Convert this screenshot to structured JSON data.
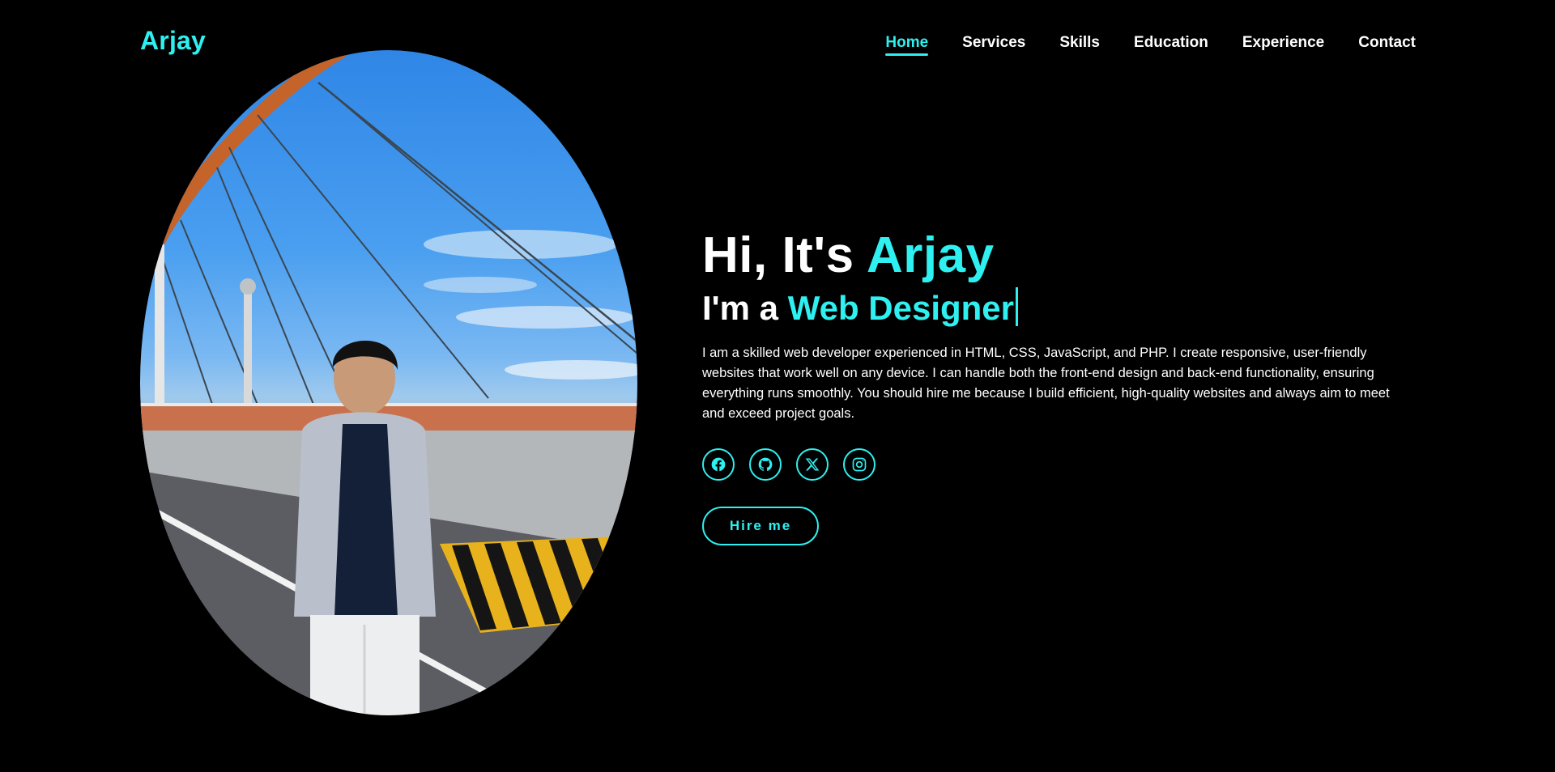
{
  "header": {
    "logo": "Arjay",
    "nav": [
      "Home",
      "Services",
      "Skills",
      "Education",
      "Experience",
      "Contact"
    ],
    "active_index": 0
  },
  "hero": {
    "greeting_prefix": "Hi, It's",
    "greeting_name": "Arjay",
    "role_prefix": "I'm a",
    "role_value": "Web Designer",
    "description": "I am a skilled web developer experienced in HTML, CSS, JavaScript, and PHP. I create responsive, user-friendly websites that work well on any device. I can handle both the front-end design and back-end functionality, ensuring everything runs smoothly. You should hire me because I build efficient, high-quality websites and always aim to meet and exceed project goals.",
    "hire_button": "Hire me"
  },
  "socials": [
    {
      "icon": "facebook-icon"
    },
    {
      "icon": "github-icon"
    },
    {
      "icon": "x-icon"
    },
    {
      "icon": "instagram-icon"
    }
  ],
  "colors": {
    "accent": "#2ef0f0",
    "background": "#000000",
    "text": "#ffffff"
  }
}
